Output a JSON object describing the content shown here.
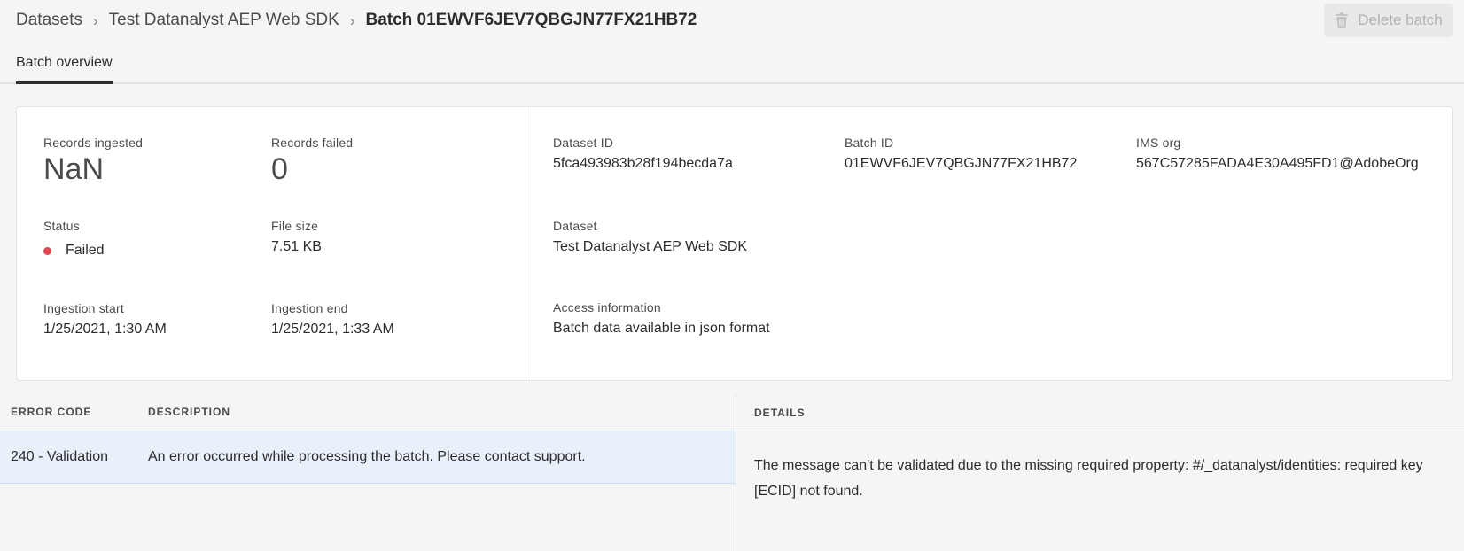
{
  "breadcrumb": {
    "items": [
      "Datasets",
      "Test Datanalyst AEP Web SDK"
    ],
    "current": "Batch 01EWVF6JEV7QBGJN77FX21HB72",
    "separator": "›"
  },
  "toolbar": {
    "delete_label": "Delete batch",
    "delete_icon": "trash-icon",
    "delete_enabled": false
  },
  "tabs": [
    {
      "label": "Batch overview",
      "active": true
    }
  ],
  "summary": {
    "records_ingested": {
      "label": "Records ingested",
      "value": "NaN"
    },
    "records_failed": {
      "label": "Records failed",
      "value": "0"
    },
    "status": {
      "label": "Status",
      "value": "Failed",
      "color": "#e34850"
    },
    "file_size": {
      "label": "File size",
      "value": "7.51 KB"
    },
    "ingestion_start": {
      "label": "Ingestion start",
      "value": "1/25/2021, 1:30 AM"
    },
    "ingestion_end": {
      "label": "Ingestion end",
      "value": "1/25/2021, 1:33 AM"
    },
    "dataset_id": {
      "label": "Dataset ID",
      "value": "5fca493983b28f194becda7a"
    },
    "batch_id": {
      "label": "Batch ID",
      "value": "01EWVF6JEV7QBGJN77FX21HB72"
    },
    "ims_org": {
      "label": "IMS org",
      "value": "567C57285FADA4E30A495FD1@AdobeOrg"
    },
    "dataset": {
      "label": "Dataset",
      "value": "Test Datanalyst AEP Web SDK"
    },
    "access": {
      "label": "Access information",
      "value": "Batch data available in json format"
    }
  },
  "errors": {
    "columns": [
      "ERROR CODE",
      "DESCRIPTION"
    ],
    "rows": [
      {
        "code": "240 - Validation",
        "description": "An error occurred while processing the batch. Please contact support."
      }
    ]
  },
  "details": {
    "header": "DETAILS",
    "text": "The message can't be validated due to the missing required property: #/_datanalyst/identities: required key [ECID] not found."
  },
  "colors": {
    "background": "#f5f5f5",
    "card": "#ffffff",
    "selected_row": "#e8f0fa",
    "status_failed": "#e34850"
  }
}
